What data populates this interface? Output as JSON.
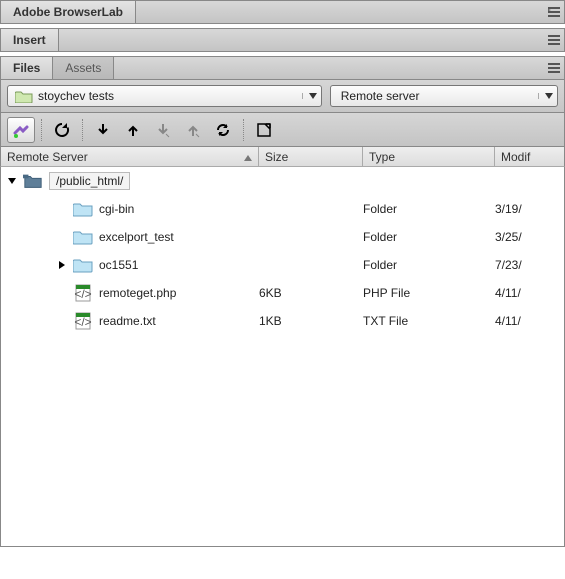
{
  "panels": {
    "browserlab": "Adobe BrowserLab",
    "insert": "Insert",
    "files": "Files",
    "assets": "Assets"
  },
  "site": {
    "name": "stoychev tests",
    "view": "Remote server"
  },
  "columns": {
    "name": "Remote Server",
    "size": "Size",
    "type": "Type",
    "modified": "Modif"
  },
  "root": {
    "path": "/public_html/"
  },
  "rows": [
    {
      "name": "cgi-bin",
      "size": "",
      "type": "Folder",
      "modified": "3/19/",
      "kind": "folder",
      "expandable": false
    },
    {
      "name": "excelport_test",
      "size": "",
      "type": "Folder",
      "modified": "3/25/",
      "kind": "folder",
      "expandable": false
    },
    {
      "name": "oc1551",
      "size": "",
      "type": "Folder",
      "modified": "7/23/",
      "kind": "folder",
      "expandable": true
    },
    {
      "name": "remoteget.php",
      "size": "6KB",
      "type": "PHP File",
      "modified": "4/11/",
      "kind": "php",
      "expandable": false
    },
    {
      "name": "readme.txt",
      "size": "1KB",
      "type": "TXT File",
      "modified": "4/11/",
      "kind": "txt",
      "expandable": false
    }
  ]
}
